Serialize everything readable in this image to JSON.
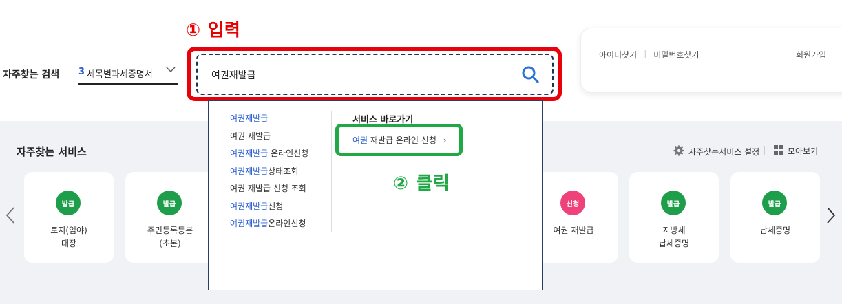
{
  "annotations": {
    "step1": "① 입력",
    "step2": "② 클릭"
  },
  "favorite_search": {
    "label": "자주찾는 검색",
    "selected_num": "3",
    "selected_text": "세목별과세증명서"
  },
  "search": {
    "value": "여권재발급"
  },
  "login": {
    "find_id": "아이디찾기",
    "find_pw": "비밀번호찾기",
    "join": "회원가입"
  },
  "dropdown": {
    "suggestions": [
      {
        "hl": "여권재발급",
        "rest": ""
      },
      {
        "hl": "",
        "rest": "여권 재발급"
      },
      {
        "hl": "여권재발급",
        "rest": " 온라인신청"
      },
      {
        "hl": "여권재발급",
        "rest": "상태조회"
      },
      {
        "hl": "",
        "rest": "여권 재발급 신청 조회"
      },
      {
        "hl": "여권재발급",
        "rest": "신청"
      },
      {
        "hl": "여권재발급",
        "rest": "온라인신청"
      }
    ],
    "shortcut_title": "서비스 바로가기",
    "shortcut": {
      "hl": "여권",
      "rest": " 재발급 온라인 신청",
      "chevron": "›"
    }
  },
  "services": {
    "title": "자주찾는 서비스",
    "settings_label": "자주찾는서비스 설정",
    "view_all_label": "모아보기",
    "cards": [
      {
        "badge": "발급",
        "badge_color": "#1e9e4a",
        "name": "토지(임야)\n대장"
      },
      {
        "badge": "발급",
        "badge_color": "#1e9e4a",
        "name": "주민등록등본\n(초본)"
      },
      {
        "badge": "신청",
        "badge_color": "#f0427a",
        "name": "여권 재발급"
      },
      {
        "badge": "발급",
        "badge_color": "#1e9e4a",
        "name": "지방세\n납세증명"
      },
      {
        "badge": "발급",
        "badge_color": "#1e9e4a",
        "name": "납세증명"
      }
    ]
  },
  "colors": {
    "accent_blue": "#2b5fd1",
    "highlight_red": "#e8000b",
    "highlight_green": "#1fa845"
  }
}
